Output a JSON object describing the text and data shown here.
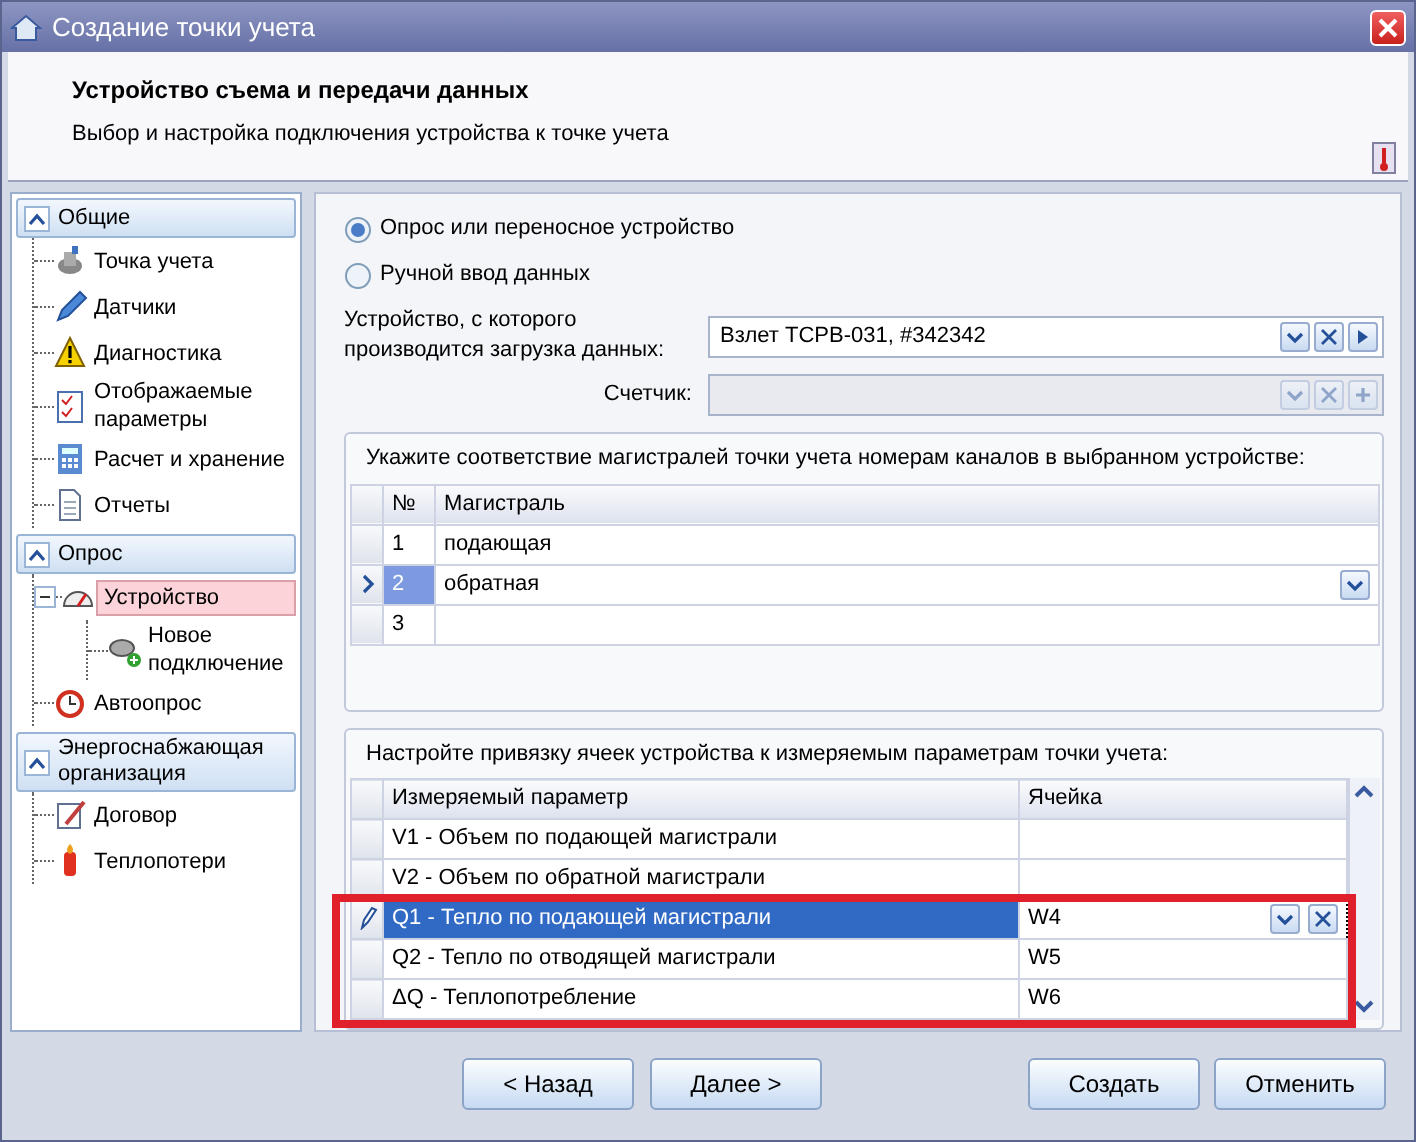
{
  "window": {
    "title": "Создание точки учета"
  },
  "header": {
    "title": "Устройство съема и передачи данных",
    "subtitle": "Выбор и настройка подключения устройства к точке учета"
  },
  "sidebar": {
    "groups": [
      {
        "label": "Общие",
        "expanded": true,
        "items": [
          {
            "label": "Точка учета",
            "selected": false
          },
          {
            "label": "Датчики",
            "selected": false
          },
          {
            "label": "Диагностика",
            "selected": false
          },
          {
            "label": "Отображаемые параметры",
            "selected": false
          },
          {
            "label": "Расчет и хранение",
            "selected": false
          },
          {
            "label": "Отчеты",
            "selected": false
          }
        ]
      },
      {
        "label": "Опрос",
        "expanded": true,
        "items": [
          {
            "label": "Устройство",
            "selected": true,
            "expanded": true,
            "children": [
              {
                "label": "Новое подключение",
                "selected": false
              }
            ]
          },
          {
            "label": "Автоопрос",
            "selected": false
          }
        ]
      },
      {
        "label": "Энергоснабжающая организация",
        "expanded": true,
        "items": [
          {
            "label": "Договор",
            "selected": false
          },
          {
            "label": "Теплопотери",
            "selected": false
          }
        ]
      }
    ]
  },
  "source_options": [
    {
      "label": "Опрос или переносное устройство",
      "selected": true
    },
    {
      "label": "Ручной ввод данных",
      "selected": false
    }
  ],
  "device_field": {
    "label": "Устройство, с которого производится загрузка данных:",
    "value": "Взлет ТСРВ-031, #342342",
    "disabled": false
  },
  "meter_field": {
    "label": "Счетчик:",
    "disabled": true
  },
  "mains": {
    "caption": "Укажите соответствие магистралей точки учета номерам каналов в выбранном устройстве:",
    "columns": [
      "№",
      "Магистраль"
    ],
    "rows": [
      {
        "number": "1",
        "name": "подающая",
        "current": false
      },
      {
        "number": "2",
        "name": "обратная",
        "current": true
      },
      {
        "number": "3",
        "current": false
      }
    ]
  },
  "params": {
    "caption": "Настройте привязку ячеек устройства к измеряемым параметрам точки учета:",
    "columns": [
      "Измеряемый параметр",
      "Ячейка"
    ],
    "rows": [
      {
        "parameter": "V1 - Объем по подающей магистрали",
        "selected": false,
        "highlighted": false
      },
      {
        "parameter": "V2 - Объем по обратной магистрали",
        "selected": false,
        "highlighted": false
      },
      {
        "parameter": "Q1 - Тепло по подающей магистрали",
        "cell": "W4",
        "selected": true,
        "highlighted": true
      },
      {
        "parameter": "Q2 - Тепло по отводящей магистрали",
        "cell": "W5",
        "selected": false,
        "highlighted": true
      },
      {
        "parameter": "ΔQ - Теплопотребление",
        "cell": "W6",
        "selected": false,
        "highlighted": true
      }
    ]
  },
  "buttons": [
    {
      "label": "< Назад"
    },
    {
      "label": "Далее >"
    },
    {
      "label": "Создать"
    },
    {
      "label": "Отменить"
    }
  ]
}
